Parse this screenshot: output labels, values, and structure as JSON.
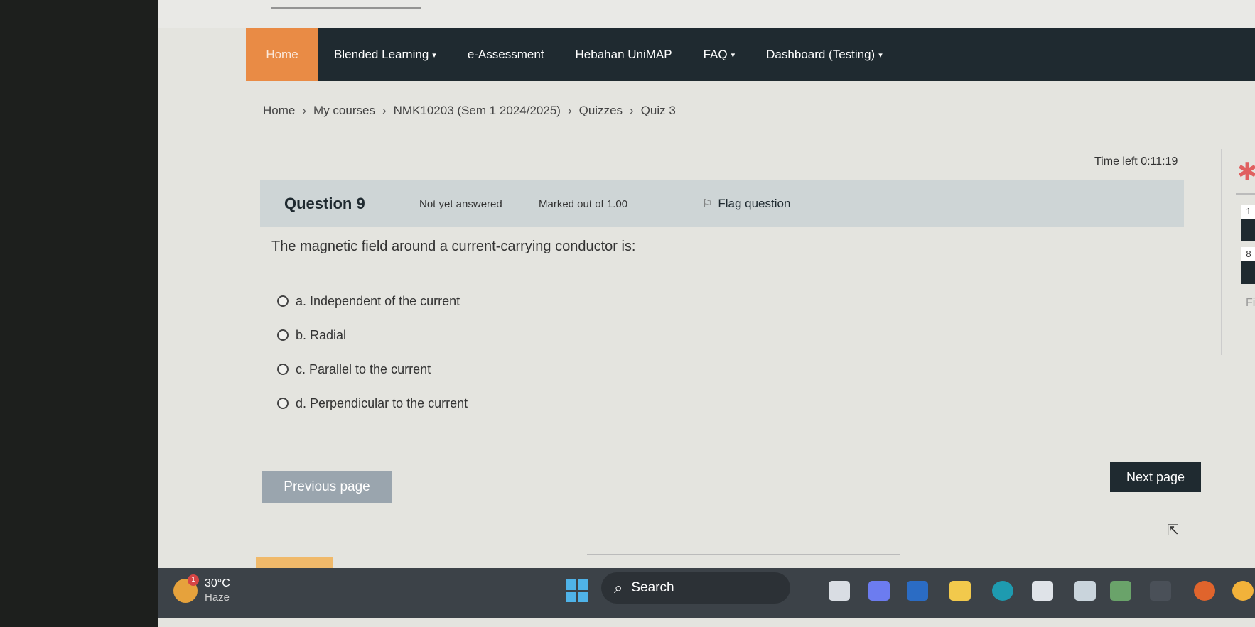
{
  "nav": {
    "items": [
      {
        "label": "Home",
        "caret": ""
      },
      {
        "label": "Blended Learning",
        "caret": "▾"
      },
      {
        "label": "e-Assessment",
        "caret": ""
      },
      {
        "label": "Hebahan UniMAP",
        "caret": ""
      },
      {
        "label": "FAQ",
        "caret": "▾"
      },
      {
        "label": "Dashboard (Testing)",
        "caret": "▾"
      }
    ]
  },
  "breadcrumb": {
    "items": [
      "Home",
      "My courses",
      "NMK10203 (Sem 1 2024/2025)",
      "Quizzes",
      "Quiz 3"
    ],
    "separator": "›"
  },
  "timer": "Time left 0:11:19",
  "question": {
    "title": "Question 9",
    "state": "Not yet answered",
    "marks": "Marked out of 1.00",
    "flag_label": "Flag question",
    "text": "The magnetic field around a current-carrying conductor is:",
    "answers": [
      "a. Independent of the current",
      "b. Radial",
      "c. Parallel to the current",
      "d. Perpendicular to the current"
    ]
  },
  "buttons": {
    "previous": "Previous page",
    "next": "Next page"
  },
  "quiz_nav": {
    "numbers": [
      "1",
      "8"
    ],
    "finish_partial": "Fin"
  },
  "taskbar": {
    "temperature": "30°C",
    "condition": "Haze",
    "badge": "1",
    "search_label": "Search"
  },
  "colors": {
    "navbar": "#1f2a30",
    "home_tab": "#e98b45",
    "question_header": "#ced5d6",
    "prev_button": "#9aa5ae",
    "next_button": "#1f2a30"
  }
}
